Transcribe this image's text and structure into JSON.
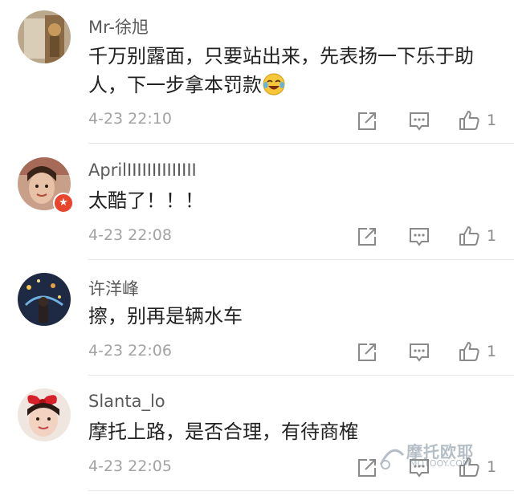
{
  "comments": [
    {
      "username": "Mr-徐旭",
      "text": "千万别露面，只要站出来，先表扬一下乐于助人，下一步拿本罚款",
      "has_emoji": true,
      "emoji": "laughing-crying-emoji",
      "time": "4-23 22:10",
      "likes": "1",
      "verified": false
    },
    {
      "username": "AprilIIIIIIIIIIIIII",
      "text": "太酷了！！！",
      "has_emoji": false,
      "time": "4-23 22:08",
      "likes": "1",
      "verified": true
    },
    {
      "username": "许洋峰",
      "text": "擦，别再是辆水车",
      "has_emoji": false,
      "time": "4-23 22:06",
      "likes": "1",
      "verified": false
    },
    {
      "username": "Slanta_lo",
      "text": "摩托上路，是否合理，有待商榷",
      "has_emoji": false,
      "time": "4-23 22:05",
      "likes": "1",
      "verified": false
    }
  ],
  "icons": {
    "share": "share-icon",
    "reply": "comment-icon",
    "like": "thumbs-up-icon"
  },
  "colors": {
    "text": "#222222",
    "username": "#5a5a5a",
    "meta": "#a3a3a3",
    "divider": "#e6e6e6",
    "verified_badge": "#e8452c"
  },
  "watermark": {
    "main": "摩托欧耶",
    "sub": "MOTOOY.COM"
  }
}
